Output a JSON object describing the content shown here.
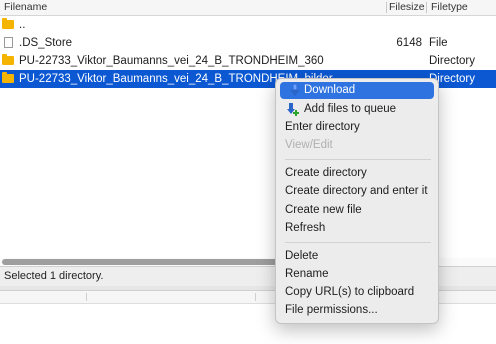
{
  "columns": {
    "filename": "Filename",
    "filesize": "Filesize",
    "filetype": "Filetype"
  },
  "rows": [
    {
      "name": "..",
      "size": "",
      "type": "",
      "icon": "folder-icon"
    },
    {
      "name": ".DS_Store",
      "size": "6148",
      "type": "File",
      "icon": "file-icon"
    },
    {
      "name": "PU-22733_Viktor_Baumanns_vei_24_B_TRONDHEIM_360",
      "size": "",
      "type": "Directory",
      "icon": "folder-icon"
    },
    {
      "name": "PU-22733_Viktor_Baumanns_vei_24_B_TRONDHEIM_bilder",
      "size": "",
      "type": "Directory",
      "icon": "folder-icon",
      "selected": true
    }
  ],
  "status": {
    "text": "Selected 1 directory."
  },
  "context_menu": {
    "download": "Download",
    "add_to_queue": "Add files to queue",
    "enter_directory": "Enter directory",
    "view_edit": "View/Edit",
    "create_directory": "Create directory",
    "create_directory_enter": "Create directory and enter it",
    "create_new_file": "Create new file",
    "refresh": "Refresh",
    "delete": "Delete",
    "rename": "Rename",
    "copy_url": "Copy URL(s) to clipboard",
    "file_permissions": "File permissions..."
  },
  "colors": {
    "selection": "#0b58d2",
    "highlight": "#2f73e0",
    "folder": "#f5b400"
  }
}
